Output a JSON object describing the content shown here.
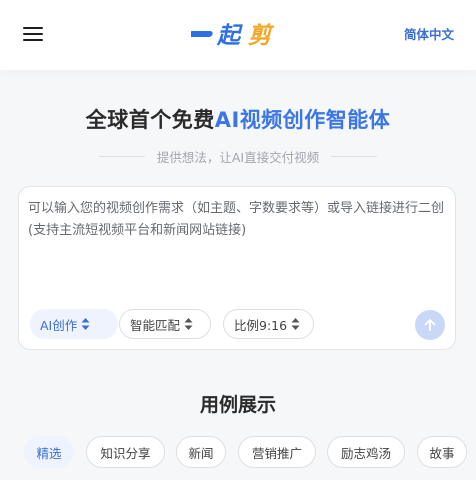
{
  "header": {
    "logo_text": "一起剪",
    "language_label": "简体中文"
  },
  "hero": {
    "title_prefix": "全球首个免费",
    "title_accent": "AI视频创作智能体",
    "subtitle": "提供想法，让AI直接交付视频"
  },
  "composer": {
    "placeholder": "可以输入您的视频创作需求（如主题、字数要求等）或导入链接进行二创(支持主流短视频平台和新闻网站链接)",
    "value": "",
    "mode_label": "AI创作",
    "match_label": "智能匹配",
    "ratio_label": "比例9:16"
  },
  "examples": {
    "title": "用例展示",
    "tabs": [
      {
        "label": "精选",
        "active": true
      },
      {
        "label": "知识分享",
        "active": false
      },
      {
        "label": "新闻",
        "active": false
      },
      {
        "label": "营销推广",
        "active": false
      },
      {
        "label": "励志鸡汤",
        "active": false
      },
      {
        "label": "故事",
        "active": false
      }
    ]
  },
  "colors": {
    "accent": "#3a76e8",
    "logo_blue": "#2f6fe4",
    "logo_orange": "#f5a623",
    "send_button": "#c9d8f6"
  }
}
